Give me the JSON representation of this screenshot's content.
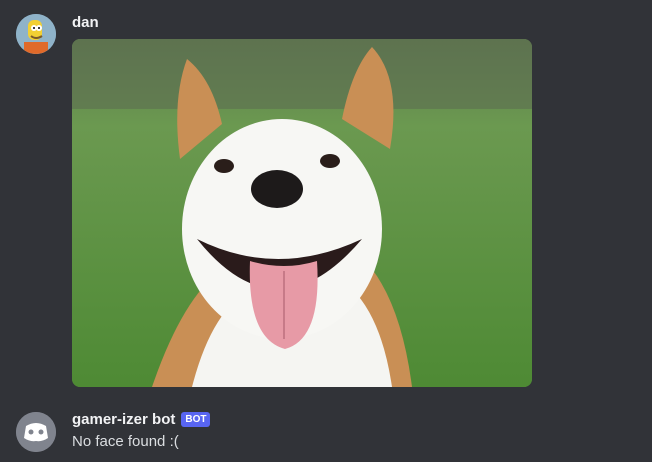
{
  "messages": [
    {
      "author": "dan",
      "avatar_icon": "simpsons-character-avatar",
      "attachment": {
        "type": "image",
        "description_icon": "smiling-dog-photo"
      }
    },
    {
      "author": "gamer-izer bot",
      "badge": "BOT",
      "avatar_icon": "discord-bot-avatar",
      "text": "No face found :("
    }
  ],
  "colors": {
    "background": "#313338",
    "author": "#f2f3f5",
    "text": "#dbdee1",
    "bot_badge": "#5865f2"
  }
}
